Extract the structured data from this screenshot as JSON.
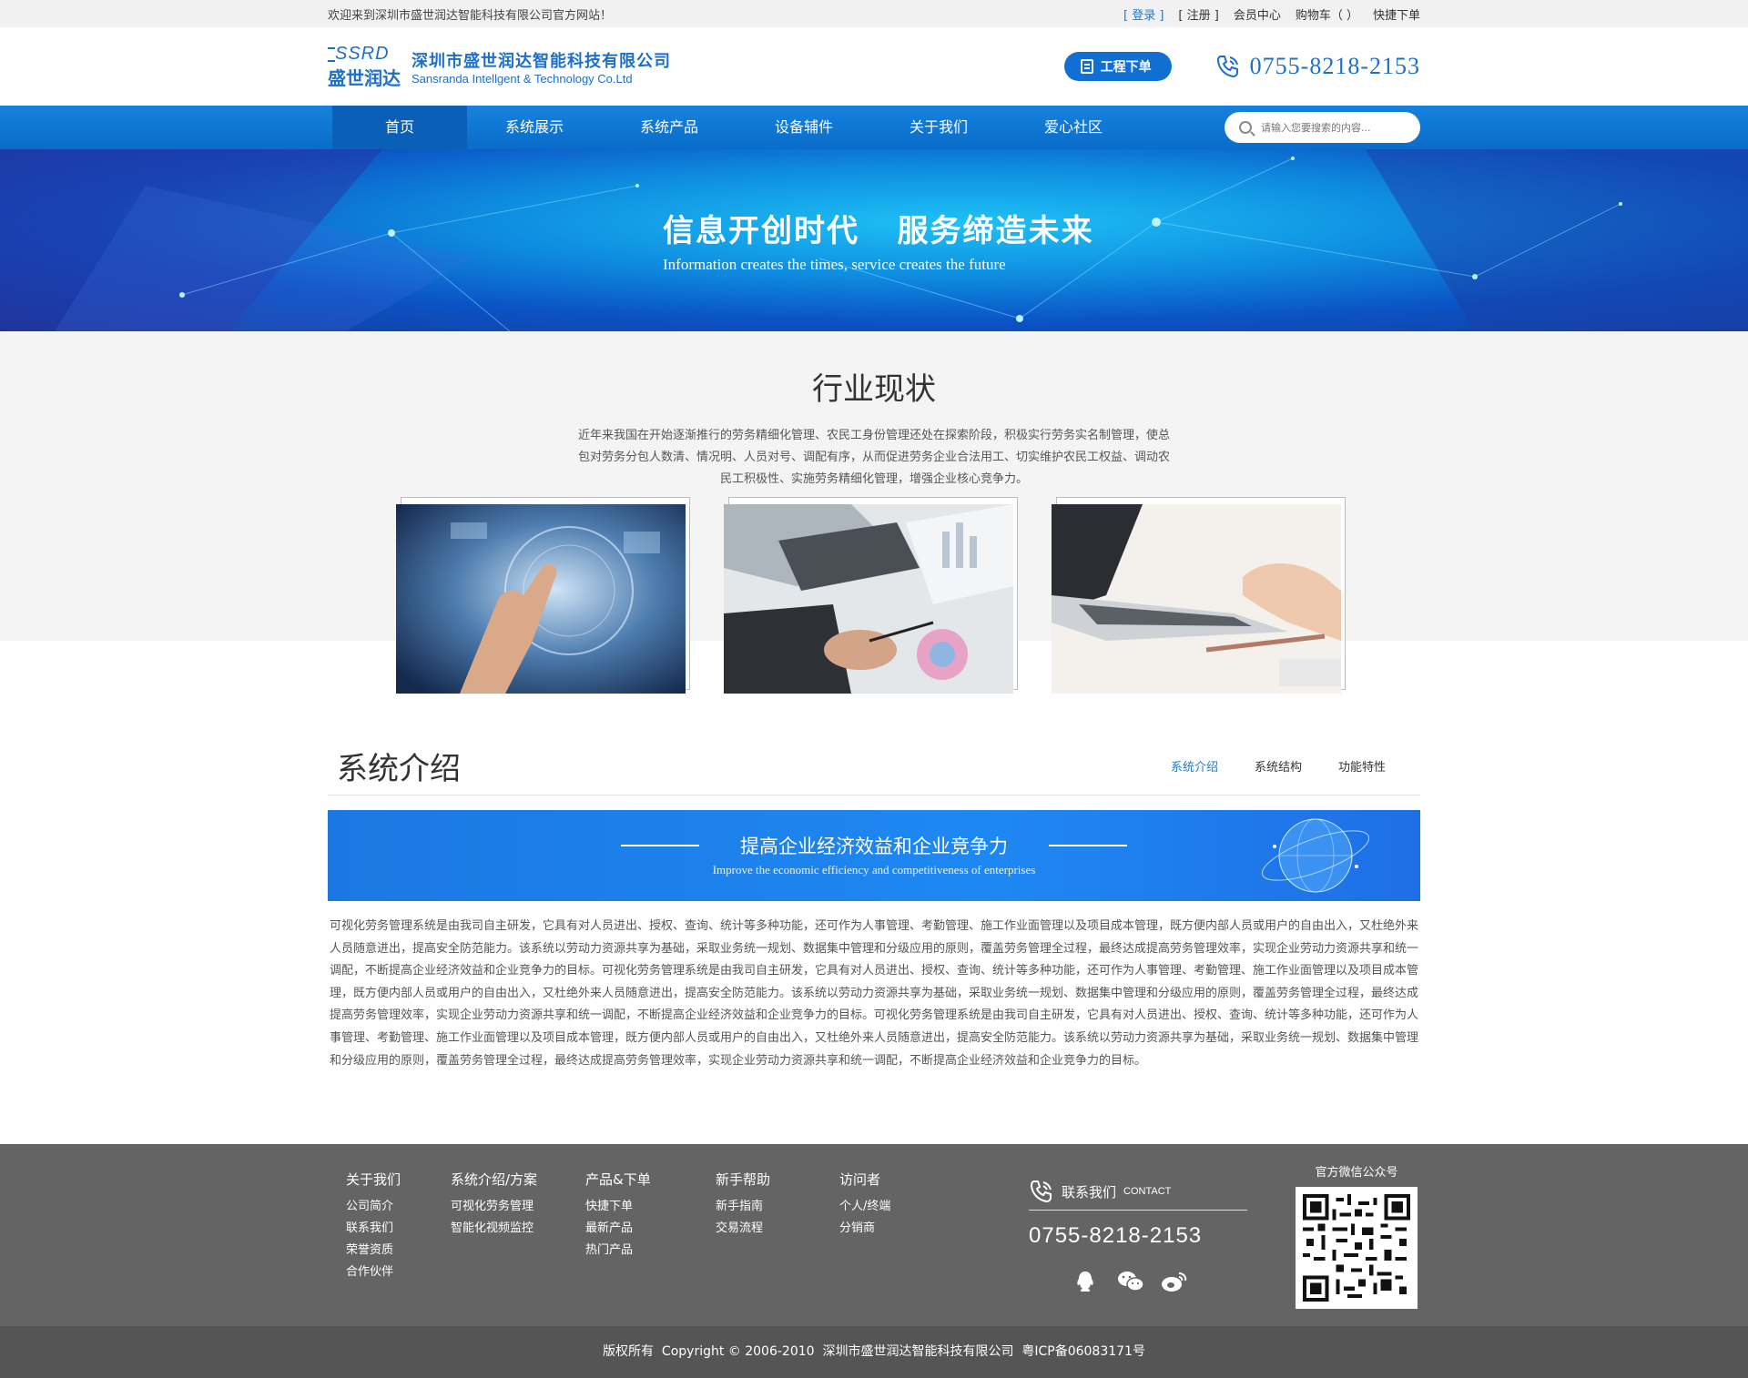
{
  "topbar": {
    "welcome": "欢迎来到深圳市盛世润达智能科技有限公司官方网站！",
    "login": "[ 登录 ]",
    "register": "[ 注册 ]",
    "member": "会员中心",
    "cart": "购物车（ ）",
    "quick_order": "快捷下单"
  },
  "header": {
    "logo_mark": "SSRD",
    "logo_mark_cn": "盛世润达",
    "company_cn": "深圳市盛世润达智能科技有限公司",
    "company_en": "Sansranda Intellgent & Technology Co.Ltd",
    "order_button": "工程下单",
    "phone": "0755-8218-2153"
  },
  "nav": {
    "items": [
      "首页",
      "系统展示",
      "系统产品",
      "设备辅件",
      "关于我们",
      "爱心社区"
    ],
    "search_placeholder": "请输入您要搜索的内容..."
  },
  "banner": {
    "slogan_cn": "信息开创时代   服务缔造未来",
    "slogan_en": "Information creates the times, service creates the future"
  },
  "industry": {
    "title": "行业现状",
    "description": "近年来我国在开始逐渐推行的劳务精细化管理、农民工身份管理还处在探索阶段，积极实行劳务实名制管理，使总包对劳务分包人数清、情况明、人员对号、调配有序，从而促进劳务企业合法用工、切实维护农民工权益、调动农民工积极性、实施劳务精细化管理，增强企业核心竞争力。"
  },
  "system": {
    "title": "系统介绍",
    "tabs": [
      "系统介绍",
      "系统结构",
      "功能特性"
    ],
    "banner_title": "提高企业经济效益和企业竞争力",
    "banner_sub": "Improve the economic efficiency and competitiveness of enterprises",
    "text": "可视化劳务管理系统是由我司自主研发，它具有对人员进出、授权、查询、统计等多种功能，还可作为人事管理、考勤管理、施工作业面管理以及项目成本管理，既方便内部人员或用户的自由出入，又杜绝外来人员随意进出，提高安全防范能力。该系统以劳动力资源共享为基础，采取业务统一规划、数据集中管理和分级应用的原则，覆盖劳务管理全过程，最终达成提高劳务管理效率，实现企业劳动力资源共享和统一调配，不断提高企业经济效益和企业竞争力的目标。可视化劳务管理系统是由我司自主研发，它具有对人员进出、授权、查询、统计等多种功能，还可作为人事管理、考勤管理、施工作业面管理以及项目成本管理，既方便内部人员或用户的自由出入，又杜绝外来人员随意进出，提高安全防范能力。该系统以劳动力资源共享为基础，采取业务统一规划、数据集中管理和分级应用的原则，覆盖劳务管理全过程，最终达成提高劳务管理效率，实现企业劳动力资源共享和统一调配，不断提高企业经济效益和企业竞争力的目标。可视化劳务管理系统是由我司自主研发，它具有对人员进出、授权、查询、统计等多种功能，还可作为人事管理、考勤管理、施工作业面管理以及项目成本管理，既方便内部人员或用户的自由出入，又杜绝外来人员随意进出，提高安全防范能力。该系统以劳动力资源共享为基础，采取业务统一规划、数据集中管理和分级应用的原则，覆盖劳务管理全过程，最终达成提高劳务管理效率，实现企业劳动力资源共享和统一调配，不断提高企业经济效益和企业竞争力的目标。"
  },
  "footer": {
    "columns": [
      {
        "title": "关于我们",
        "items": [
          "公司简介",
          "联系我们",
          "荣誉资质",
          "合作伙伴"
        ]
      },
      {
        "title": "系统介绍/方案",
        "items": [
          "可视化劳务管理",
          "智能化视频监控"
        ]
      },
      {
        "title": "产品&下单",
        "items": [
          "快捷下单",
          "最新产品",
          "热门产品"
        ]
      },
      {
        "title": "新手帮助",
        "items": [
          "新手指南",
          "交易流程"
        ]
      },
      {
        "title": "访问者",
        "items": [
          "个人/终端",
          "分销商"
        ]
      }
    ],
    "contact_title": "联系我们",
    "contact_en": "CONTACT",
    "contact_phone": "0755-8218-2153",
    "qr_label": "官方微信公众号",
    "social_icons": [
      "qq-icon",
      "wechat-icon",
      "weibo-icon"
    ]
  },
  "copyright": "版权所有  Copyright © 2006-2010  深圳市盛世润达智能科技有限公司  粤ICP备06083171号",
  "colors": {
    "brand_blue": "#1e6fc8",
    "nav_blue": "#0f72d6",
    "footer_gray": "#646464",
    "copyright_gray": "#555555"
  }
}
